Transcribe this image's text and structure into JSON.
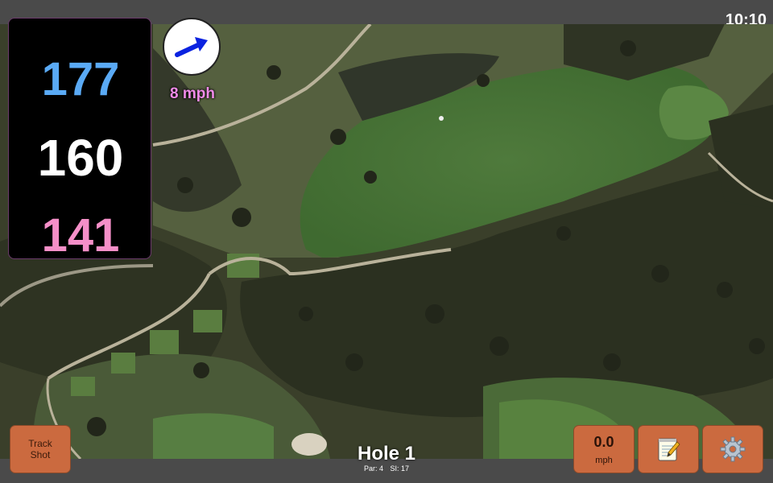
{
  "status": {
    "time": "10:10"
  },
  "distances": {
    "back": "177",
    "middle": "160",
    "front": "141",
    "colors": {
      "back": "#5aaaf5",
      "middle": "#ffffff",
      "front": "#f58fc8"
    }
  },
  "wind": {
    "speed": "8 mph",
    "arrow_color": "#0a22e0",
    "speed_color": "#f08be8",
    "icon": "wind-direction-arrow"
  },
  "buttons": {
    "track_shot": [
      "Track",
      "Shot"
    ],
    "speed_value": "0.0",
    "speed_unit": "mph",
    "notes_icon": "notepad-pencil-icon",
    "settings_icon": "gear-icon",
    "color": "#cb6a3f"
  },
  "hole": {
    "title": "Hole 1",
    "par": "Par: 4",
    "si": "SI: 17"
  },
  "map": {
    "description_icon": "satellite-golf-hole-map"
  }
}
